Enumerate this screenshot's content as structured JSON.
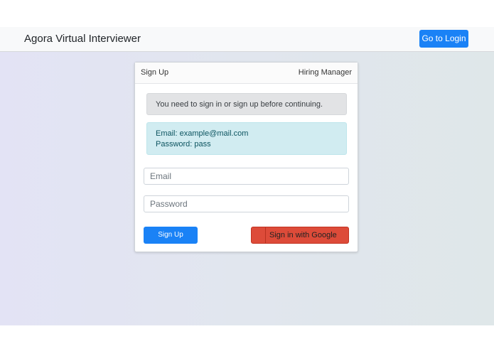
{
  "navbar": {
    "brand": "Agora Virtual Interviewer",
    "login_button": "Go to Login"
  },
  "card": {
    "header_left": "Sign Up",
    "header_right": "Hiring Manager",
    "notice": "You need to sign in or sign up before continuing.",
    "credentials": {
      "email_line": "Email: example@mail.com",
      "password_line": "Password: pass"
    },
    "form": {
      "email_placeholder": "Email",
      "password_placeholder": "Password",
      "signup_label": "Sign Up",
      "google_label": "Sign in with Google"
    }
  },
  "colors": {
    "primary": "#1a82f6",
    "google": "#dd4b39",
    "alert_info_bg": "#d1ecf1",
    "alert_gray_bg": "#e2e3e5"
  }
}
